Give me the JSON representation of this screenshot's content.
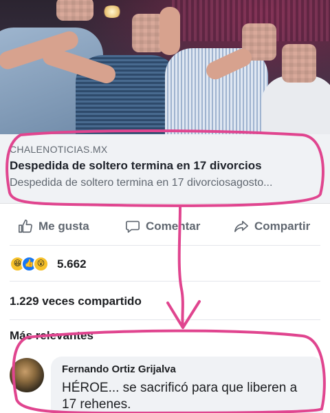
{
  "post": {
    "image_alt": "Grupo de hombres celebrando con los rostros pixelados",
    "link": {
      "domain": "CHALENOTICIAS.MX",
      "headline": "Despedida de soltero termina en 17 divorcios",
      "description": "Despedida de soltero termina en 17 divorciosagosto..."
    },
    "actions": {
      "like": "Me gusta",
      "comment": "Comentar",
      "share": "Compartir"
    },
    "reactions": {
      "icons": [
        "haha-icon",
        "like-icon",
        "wow-icon"
      ],
      "count": "5.662"
    },
    "shares_text": "1.229 veces compartido"
  },
  "comments": {
    "filter_label": "Más relevantes",
    "items": [
      {
        "author": "Fernando Ortiz Grijalva",
        "text": "HÉROE... se sacrificó para que liberen a 17 rehenes."
      }
    ]
  },
  "colors": {
    "annotation": "#e0458f",
    "preview_bg": "#f0f2f5",
    "action_text": "#606770",
    "like_blue": "#1877f2"
  }
}
